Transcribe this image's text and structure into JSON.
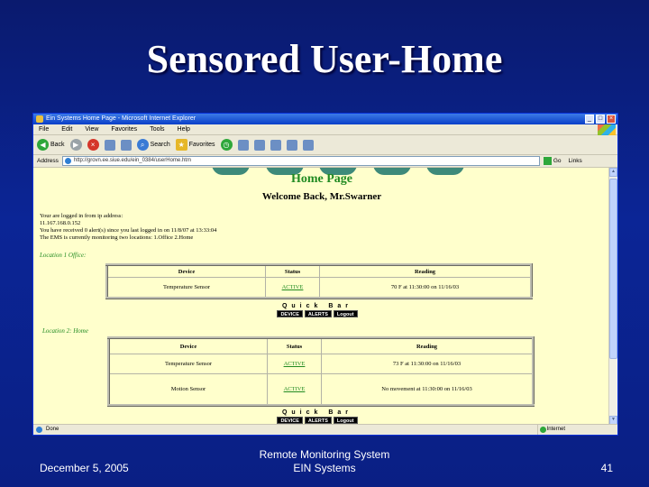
{
  "slide": {
    "title": "Sensored User-Home",
    "date": "December 5, 2005",
    "footer_line1": "Remote Monitoring System",
    "footer_line2": "EIN Systems",
    "page_number": "41"
  },
  "browser": {
    "title": "Ein Systems Home Page - Microsoft Internet Explorer",
    "menu": [
      "File",
      "Edit",
      "View",
      "Favorites",
      "Tools",
      "Help"
    ],
    "toolbar": {
      "back": "Back",
      "search": "Search",
      "favorites": "Favorites"
    },
    "address_label": "Address",
    "address_value": "http://grovn.ee.siue.edu/ein_0384/userHome.htm",
    "go_label": "Go",
    "links_label": "Links",
    "status_text": "Done",
    "zone_text": "Internet"
  },
  "page": {
    "heading": "Home Page",
    "welcome": "Welcome Back, Mr.Swarner",
    "info_lines": [
      "Your are logged in from ip address:",
      "11.167.168.0.152",
      "You have received 0 alert(s) since you last logged in on  11/8/07 at 13:33:04",
      "The EMS is currently monitoring two locations: 1.Office 2.Home"
    ],
    "location1_label": "Location 1 Office:",
    "location2_label": "Location 2: Home",
    "table_headers": [
      "Device",
      "Status",
      "Reading"
    ],
    "office_rows": [
      {
        "device": "Temperature Sensor",
        "status": "ACTIVE",
        "reading": "70 F at 11:30:00 on 11/16/03"
      }
    ],
    "home_rows": [
      {
        "device": "Temperature Sensor",
        "status": "ACTIVE",
        "reading": "73 F at 11:30:00 on 11/16/03"
      },
      {
        "device": "Motion Sensor",
        "status": "ACTIVE",
        "reading": "No movement at 11:30:00 on 11/16/03"
      }
    ],
    "quick_bar_title": "Quick Bar",
    "quick_buttons": [
      "DEVICE",
      "ALERTS",
      "Logout"
    ]
  },
  "colors": {
    "slide_background": "#0b2596",
    "page_background": "#ffffcc",
    "heading_green": "#228b22"
  }
}
